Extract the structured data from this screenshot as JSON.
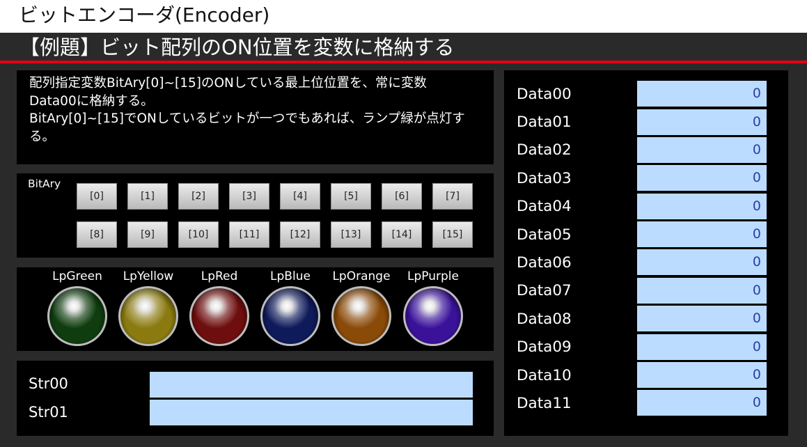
{
  "window": {
    "title": "ビットエンコーダ(Encoder)"
  },
  "header": {
    "title": "【例題】ビット配列のON位置を変数に格納する"
  },
  "description": {
    "line1": "配列指定変数BitAry[0]~[15]のONしている最上位位置を、常に変数",
    "line2": "Data00に格納する。",
    "line3": "BitAry[0]~[15]でONしているビットが一つでもあれば、ランプ緑が点灯す",
    "line4": "る。"
  },
  "bits": {
    "label": "BitAry",
    "buttons": [
      "[0]",
      "[1]",
      "[2]",
      "[3]",
      "[4]",
      "[5]",
      "[6]",
      "[7]",
      "[8]",
      "[9]",
      "[10]",
      "[11]",
      "[12]",
      "[13]",
      "[14]",
      "[15]"
    ]
  },
  "lamps": [
    {
      "name": "LpGreen",
      "color": "#0f3d0f"
    },
    {
      "name": "LpYellow",
      "color": "#8a7a10"
    },
    {
      "name": "LpRed",
      "color": "#6e0e0e"
    },
    {
      "name": "LpBlue",
      "color": "#0e1a5a"
    },
    {
      "name": "LpOrange",
      "color": "#8a4a08"
    },
    {
      "name": "LpPurple",
      "color": "#3a129a"
    }
  ],
  "strings": [
    {
      "label": "Str00",
      "value": ""
    },
    {
      "label": "Str01",
      "value": ""
    }
  ],
  "data": [
    {
      "label": "Data00",
      "value": "0"
    },
    {
      "label": "Data01",
      "value": "0"
    },
    {
      "label": "Data02",
      "value": "0"
    },
    {
      "label": "Data03",
      "value": "0"
    },
    {
      "label": "Data04",
      "value": "0"
    },
    {
      "label": "Data05",
      "value": "0"
    },
    {
      "label": "Data06",
      "value": "0"
    },
    {
      "label": "Data07",
      "value": "0"
    },
    {
      "label": "Data08",
      "value": "0"
    },
    {
      "label": "Data09",
      "value": "0"
    },
    {
      "label": "Data10",
      "value": "0"
    },
    {
      "label": "Data11",
      "value": "0"
    }
  ],
  "colors": {
    "accent_line": "#e60012",
    "field_bg": "#bcdcff",
    "value_text": "#2a3ea8"
  }
}
